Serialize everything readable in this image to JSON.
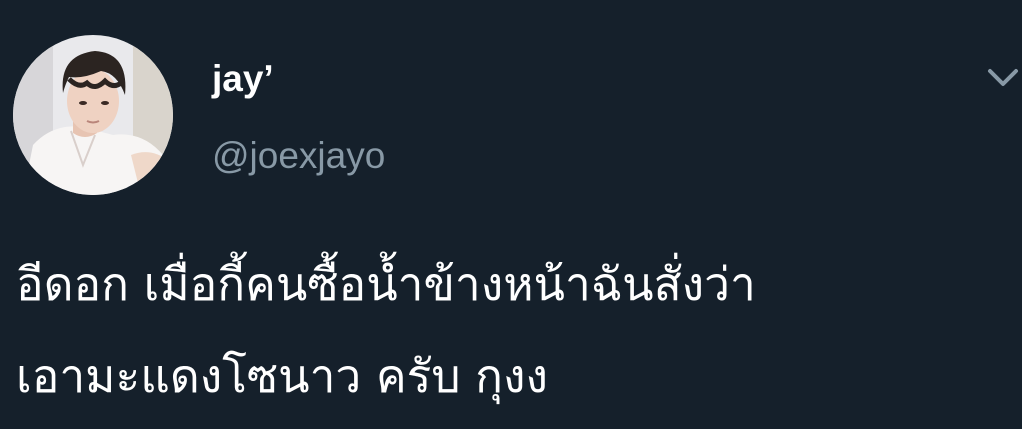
{
  "author": {
    "display_name": "jay’",
    "handle": "@joexjayo",
    "avatar_icon": "user-avatar"
  },
  "tweet": {
    "lines": [
      "อีดอก เมื่อกี้คนซื้อน้ำข้างหน้าฉันสั่งว่า",
      "เอามะแดงโซนาว ครับ กุงง"
    ]
  },
  "menu": {
    "icon": "chevron-down-icon"
  },
  "colors": {
    "background": "#15202b",
    "primary_text": "#ffffff",
    "secondary_text": "#8899a6",
    "chevron": "#8899a6"
  }
}
